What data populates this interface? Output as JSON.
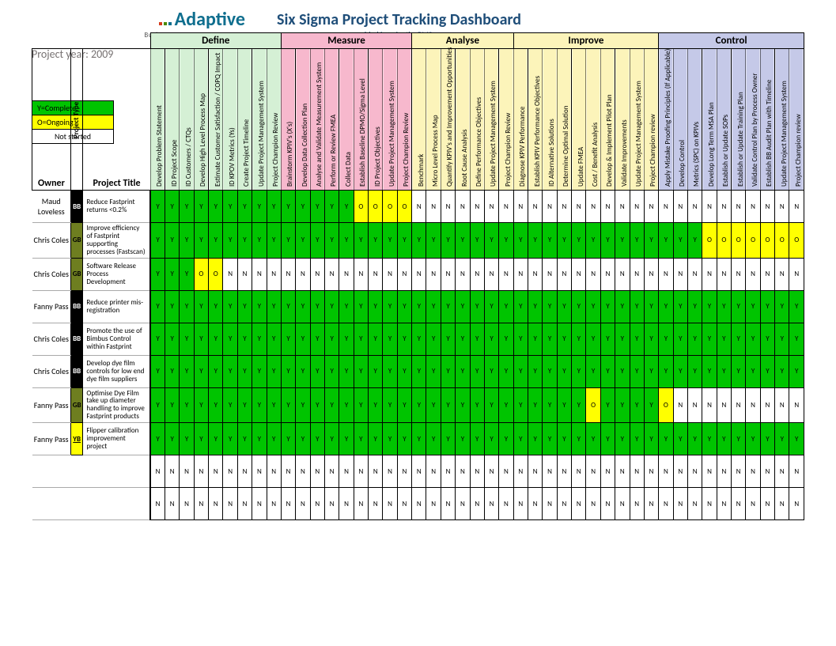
{
  "branding": {
    "name": "Adaptive",
    "tagline": "Business Management Systems"
  },
  "title": "Six Sigma Project Tracking Dashboard",
  "subtitle": "provided by adaptiveBMS.com",
  "project_year_label": "Project year:",
  "project_year": "2009",
  "legend": {
    "complete": "Y=Complete",
    "ongoing": "O=Ongoing",
    "notstarted": "Not started"
  },
  "headers": {
    "owner": "Owner",
    "project_type": "Project Type",
    "project_title": "Project Title"
  },
  "phases": [
    {
      "name": "Define",
      "class": "phase-define",
      "subs": [
        "Develop Problem Statement",
        "ID Project Scope",
        "ID Customers / CTQs",
        "Develop High Level Process Map",
        "Estimate Customer Satisfaction / COPQ Impact",
        "ID KPOV Metrics (Ys)",
        "Create Project Timeline",
        "Update Project Management System",
        "Project Champion Review"
      ]
    },
    {
      "name": "Measure",
      "class": "phase-measure",
      "subs": [
        "Brainstorm KPIV's (X's)",
        "Develop Data Collection Plan",
        "Analyse and Validate Measurement System",
        "Perform or Review FMEA",
        "Collect Data",
        "Establish Baseline DPMO/Sigma Level",
        "ID Project Objectives",
        "Update Project Management System",
        "Project Champion Review"
      ]
    },
    {
      "name": "Analyse",
      "class": "phase-analyse",
      "subs": [
        "Benchmark",
        "Micro Level Process Map",
        "Quantify KPIV's and Improvement Opportunities",
        "Root Cause Analysis",
        "Define Performance Objectives",
        "Update Project Management System",
        "Project Champion Review"
      ]
    },
    {
      "name": "Improve",
      "class": "phase-improve",
      "subs": [
        "Diagnose KPIV Performance",
        "Establish KPIV Performance Objectives",
        "ID Alternative Solutions",
        "Determine Optimal Solution",
        "Update FMEA",
        "Cost / Benefit Analysis",
        "Develop & Implement Pilot Plan",
        "Validate Improvements",
        "Update Project Management System",
        "Project Champion review"
      ]
    },
    {
      "name": "Control",
      "class": "phase-control",
      "subs": [
        "Apply Mistake Proofing Principles (If Applicable)",
        "Develop Control",
        "Metrics (SPC) on KPIVs",
        "Develop Long Term MSA Plan",
        "Establish or Update SOPs",
        "Establish or Update Training Plan",
        "Validate Control Plan by Process Owner",
        "Establish BB Audit Plan with Timeline",
        "Update Project Management System",
        "Project Champion review"
      ]
    }
  ],
  "rows": [
    {
      "owner": "Maud Loveless",
      "type": "BB",
      "title": "Reduce Fastprint returns <0.2%",
      "status": [
        "Y",
        "Y",
        "Y",
        "Y",
        "Y",
        "Y",
        "Y",
        "Y",
        "Y",
        "Y",
        "Y",
        "Y",
        "Y",
        "Y",
        "O",
        "O",
        "O",
        "O",
        "N",
        "N",
        "N",
        "N",
        "N",
        "N",
        "N",
        "N",
        "N",
        "N",
        "N",
        "N",
        "N",
        "N",
        "N",
        "N",
        "N",
        "N",
        "N",
        "N",
        "N",
        "N",
        "N",
        "N",
        "N",
        "N",
        "N"
      ]
    },
    {
      "owner": "Chris Coles",
      "type": "GB",
      "title": "Improve efficiency of Fastprint supporting processes (Fastscan)",
      "status": [
        "Y",
        "Y",
        "Y",
        "Y",
        "Y",
        "Y",
        "Y",
        "Y",
        "Y",
        "Y",
        "Y",
        "Y",
        "Y",
        "Y",
        "Y",
        "Y",
        "Y",
        "Y",
        "Y",
        "Y",
        "Y",
        "Y",
        "Y",
        "Y",
        "Y",
        "Y",
        "Y",
        "Y",
        "Y",
        "Y",
        "Y",
        "Y",
        "Y",
        "Y",
        "Y",
        "Y",
        "Y",
        "Y",
        "O",
        "O",
        "O",
        "O",
        "O",
        "O",
        "O"
      ]
    },
    {
      "owner": "Chris Coles",
      "type": "GB",
      "title": "Software Release Process Development",
      "status": [
        "Y",
        "Y",
        "Y",
        "O",
        "O",
        "N",
        "N",
        "N",
        "N",
        "N",
        "N",
        "N",
        "N",
        "N",
        "N",
        "N",
        "N",
        "N",
        "N",
        "N",
        "N",
        "N",
        "N",
        "N",
        "N",
        "N",
        "N",
        "N",
        "N",
        "N",
        "N",
        "N",
        "N",
        "N",
        "N",
        "N",
        "N",
        "N",
        "N",
        "N",
        "N",
        "N",
        "N",
        "N",
        "N"
      ]
    },
    {
      "owner": "Fanny Pass",
      "type": "BB",
      "title": "Reduce printer mis-registration",
      "status": [
        "Y",
        "Y",
        "Y",
        "Y",
        "Y",
        "Y",
        "Y",
        "Y",
        "Y",
        "Y",
        "Y",
        "Y",
        "Y",
        "Y",
        "Y",
        "Y",
        "Y",
        "Y",
        "Y",
        "Y",
        "Y",
        "Y",
        "Y",
        "Y",
        "Y",
        "Y",
        "Y",
        "Y",
        "Y",
        "Y",
        "Y",
        "Y",
        "Y",
        "Y",
        "Y",
        "Y",
        "Y",
        "Y",
        "Y",
        "Y",
        "Y",
        "Y",
        "Y",
        "Y",
        "Y"
      ]
    },
    {
      "owner": "Chris Coles",
      "type": "BB",
      "title": "Promote the use of Bimbus Control within Fastprint",
      "status": [
        "Y",
        "Y",
        "Y",
        "Y",
        "Y",
        "Y",
        "Y",
        "Y",
        "Y",
        "Y",
        "Y",
        "Y",
        "Y",
        "Y",
        "Y",
        "Y",
        "Y",
        "Y",
        "Y",
        "Y",
        "Y",
        "Y",
        "Y",
        "Y",
        "Y",
        "Y",
        "Y",
        "Y",
        "Y",
        "Y",
        "Y",
        "Y",
        "Y",
        "Y",
        "Y",
        "Y",
        "Y",
        "Y",
        "Y",
        "Y",
        "Y",
        "Y",
        "Y",
        "Y",
        "Y"
      ]
    },
    {
      "owner": "Chris Coles",
      "type": "BB",
      "title": "Develop dye film controls for low end dye film suppliers",
      "status": [
        "Y",
        "Y",
        "Y",
        "Y",
        "Y",
        "Y",
        "Y",
        "Y",
        "Y",
        "Y",
        "Y",
        "Y",
        "Y",
        "Y",
        "Y",
        "Y",
        "Y",
        "Y",
        "Y",
        "Y",
        "Y",
        "Y",
        "Y",
        "Y",
        "Y",
        "Y",
        "Y",
        "Y",
        "Y",
        "Y",
        "Y",
        "Y",
        "Y",
        "Y",
        "Y",
        "Y",
        "Y",
        "Y",
        "Y",
        "Y",
        "Y",
        "Y",
        "Y",
        "Y",
        "Y"
      ]
    },
    {
      "owner": "Fanny Pass",
      "type": "GB",
      "title": "Optimise Dye Film take up diameter handling to improve Fastprint products",
      "status": [
        "Y",
        "Y",
        "Y",
        "Y",
        "Y",
        "Y",
        "Y",
        "Y",
        "Y",
        "Y",
        "Y",
        "Y",
        "Y",
        "Y",
        "Y",
        "Y",
        "Y",
        "Y",
        "Y",
        "Y",
        "Y",
        "Y",
        "Y",
        "Y",
        "Y",
        "Y",
        "Y",
        "Y",
        "Y",
        "Y",
        "O",
        "Y",
        "Y",
        "Y",
        "Y",
        "O",
        "N",
        "N",
        "N",
        "N",
        "N",
        "N",
        "N",
        "N",
        "N"
      ]
    },
    {
      "owner": "Fanny Pass",
      "type": "YB",
      "title": "Flipper calibration improvement project",
      "status": [
        "Y",
        "Y",
        "Y",
        "Y",
        "Y",
        "Y",
        "Y",
        "Y",
        "Y",
        "Y",
        "Y",
        "Y",
        "Y",
        "Y",
        "Y",
        "Y",
        "Y",
        "Y",
        "Y",
        "Y",
        "Y",
        "Y",
        "Y",
        "Y",
        "Y",
        "Y",
        "Y",
        "Y",
        "Y",
        "Y",
        "Y",
        "Y",
        "Y",
        "Y",
        "Y",
        "Y",
        "Y",
        "Y",
        "Y",
        "Y",
        "Y",
        "Y",
        "Y",
        "Y",
        "Y"
      ]
    },
    {
      "owner": "",
      "type": "",
      "title": "",
      "status": [
        "N",
        "N",
        "N",
        "N",
        "N",
        "N",
        "N",
        "N",
        "N",
        "N",
        "N",
        "N",
        "N",
        "N",
        "N",
        "N",
        "N",
        "N",
        "N",
        "N",
        "N",
        "N",
        "N",
        "N",
        "N",
        "N",
        "N",
        "N",
        "N",
        "N",
        "N",
        "N",
        "N",
        "N",
        "N",
        "N",
        "N",
        "N",
        "N",
        "N",
        "N",
        "N",
        "N",
        "N",
        "N"
      ]
    },
    {
      "owner": "",
      "type": "",
      "title": "",
      "status": [
        "N",
        "N",
        "N",
        "N",
        "N",
        "N",
        "N",
        "N",
        "N",
        "N",
        "N",
        "N",
        "N",
        "N",
        "N",
        "N",
        "N",
        "N",
        "N",
        "N",
        "N",
        "N",
        "N",
        "N",
        "N",
        "N",
        "N",
        "N",
        "N",
        "N",
        "N",
        "N",
        "N",
        "N",
        "N",
        "N",
        "N",
        "N",
        "N",
        "N",
        "N",
        "N",
        "N",
        "N",
        "N"
      ]
    }
  ]
}
